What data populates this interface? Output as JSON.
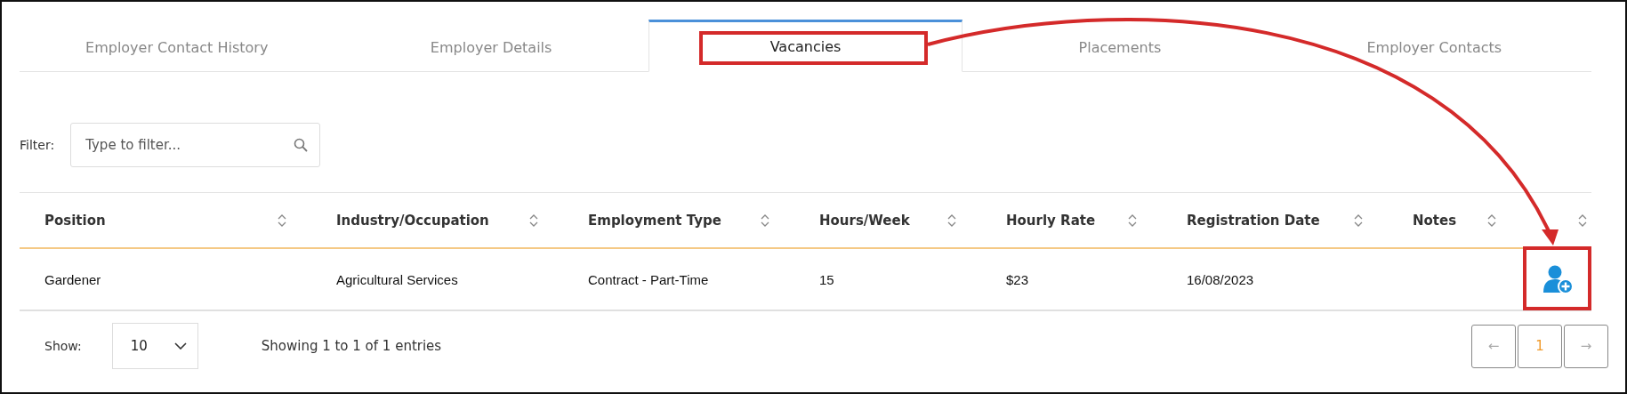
{
  "tabs": [
    {
      "label": "Employer Contact History",
      "selected": false
    },
    {
      "label": "Employer Details",
      "selected": false
    },
    {
      "label": "Vacancies",
      "selected": true
    },
    {
      "label": "Placements",
      "selected": false
    },
    {
      "label": "Employer Contacts",
      "selected": false
    }
  ],
  "filter": {
    "label": "Filter:",
    "placeholder": "Type to filter..."
  },
  "table": {
    "columns": [
      {
        "kind": "text",
        "label": "Position"
      },
      {
        "kind": "text",
        "label": "Industry/Occupation"
      },
      {
        "kind": "text",
        "label": "Employment Type"
      },
      {
        "kind": "text",
        "label": "Hours/Week"
      },
      {
        "kind": "text",
        "label": "Hourly Rate"
      },
      {
        "kind": "text",
        "label": "Registration Date"
      },
      {
        "kind": "text",
        "label": "Notes"
      },
      {
        "kind": "action"
      }
    ],
    "rows": [
      {
        "cells": [
          "Gardener",
          "Agricultural Services",
          "Contract - Part-Time",
          "15",
          "$23",
          "16/08/2023"
        ]
      }
    ]
  },
  "footer": {
    "show_label": "Show:",
    "page_size": "10",
    "info": "Showing 1 to 1 of 1 entries",
    "pagination": [
      {
        "label": "←",
        "selected": false,
        "disabled": true
      },
      {
        "label": "1",
        "selected": true,
        "disabled": false
      },
      {
        "label": "→",
        "selected": false,
        "disabled": true
      }
    ]
  }
}
